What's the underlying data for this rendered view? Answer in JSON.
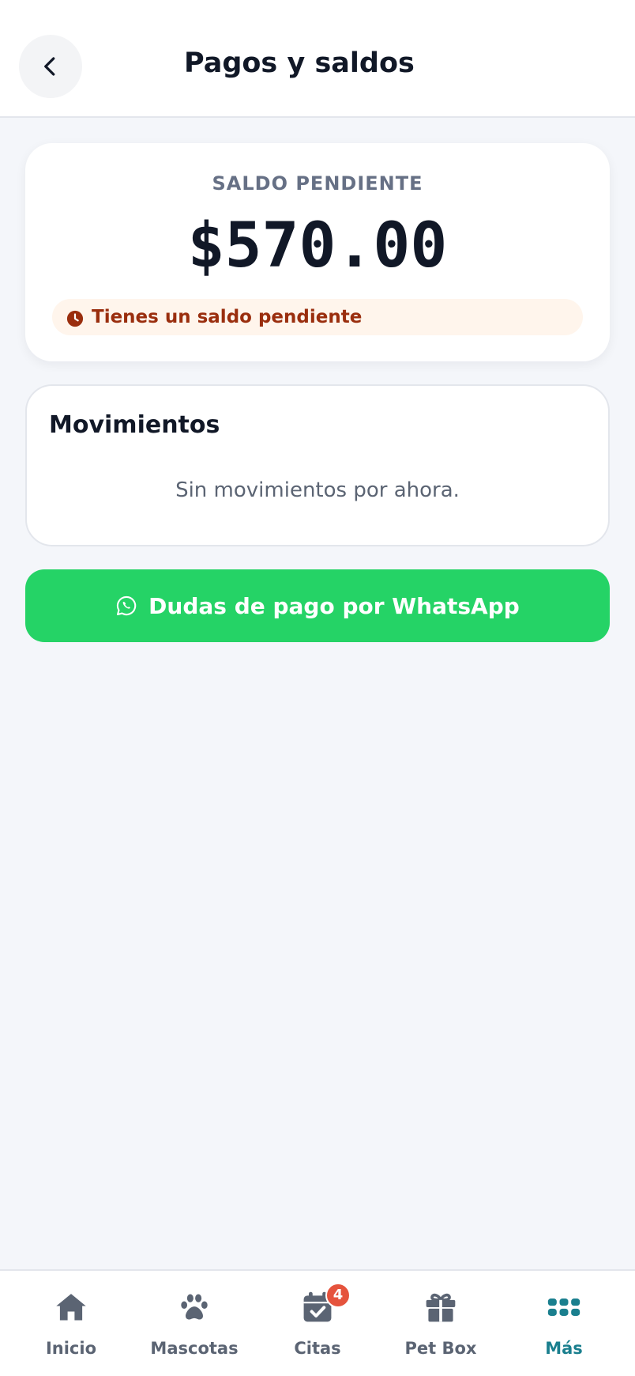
{
  "header": {
    "title": "Pagos y saldos",
    "back_icon": "chevron-left-icon"
  },
  "balance": {
    "label": "SALDO PENDIENTE",
    "amount": "$570.00",
    "notice_icon": "clock-icon",
    "notice_text": "Tienes un saldo pendiente",
    "notice_color": "#9a2e0e"
  },
  "movements": {
    "title": "Movimientos",
    "empty_text": "Sin movimientos por ahora."
  },
  "whatsapp_button": {
    "icon": "whatsapp-icon",
    "label": "Dudas de pago por WhatsApp",
    "color": "#25d366"
  },
  "bottom_nav": {
    "active_color": "#1a7f8e",
    "items": [
      {
        "label": "Inicio",
        "icon": "home-icon"
      },
      {
        "label": "Mascotas",
        "icon": "paw-icon"
      },
      {
        "label": "Citas",
        "icon": "calendar-check-icon",
        "badge": "4"
      },
      {
        "label": "Pet Box",
        "icon": "gift-icon"
      },
      {
        "label": "Más",
        "icon": "grid-icon",
        "active": true
      }
    ]
  }
}
